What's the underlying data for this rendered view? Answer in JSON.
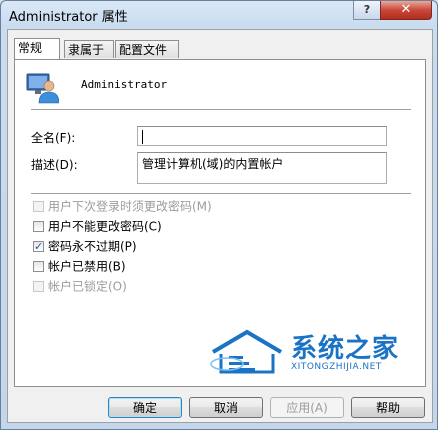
{
  "window": {
    "title": "Administrator 属性",
    "help_label": "?",
    "close_label": "✕"
  },
  "tabs": [
    {
      "label": "常规",
      "active": true
    },
    {
      "label": "隶属于",
      "active": false
    },
    {
      "label": "配置文件",
      "active": false
    }
  ],
  "user": {
    "name": "Administrator"
  },
  "fields": {
    "fullname": {
      "label": "全名(F):",
      "value": ""
    },
    "description": {
      "label": "描述(D):",
      "value": "管理计算机(域)的内置帐户"
    }
  },
  "checkboxes": [
    {
      "label": "用户下次登录时须更改密码(M)",
      "checked": false,
      "enabled": false
    },
    {
      "label": "用户不能更改密码(C)",
      "checked": false,
      "enabled": true
    },
    {
      "label": "密码永不过期(P)",
      "checked": true,
      "enabled": true
    },
    {
      "label": "帐户已禁用(B)",
      "checked": false,
      "enabled": true
    },
    {
      "label": "帐户已锁定(O)",
      "checked": false,
      "enabled": false
    }
  ],
  "buttons": {
    "ok": "确定",
    "cancel": "取消",
    "apply": "应用(A)",
    "help": "帮助"
  },
  "watermark": {
    "title": "系统之家",
    "url": "XITONGZHIJIA.NET"
  },
  "colors": {
    "accent": "#3c7fb1",
    "watermark": "#1b73c4",
    "close": "#c9483a"
  }
}
